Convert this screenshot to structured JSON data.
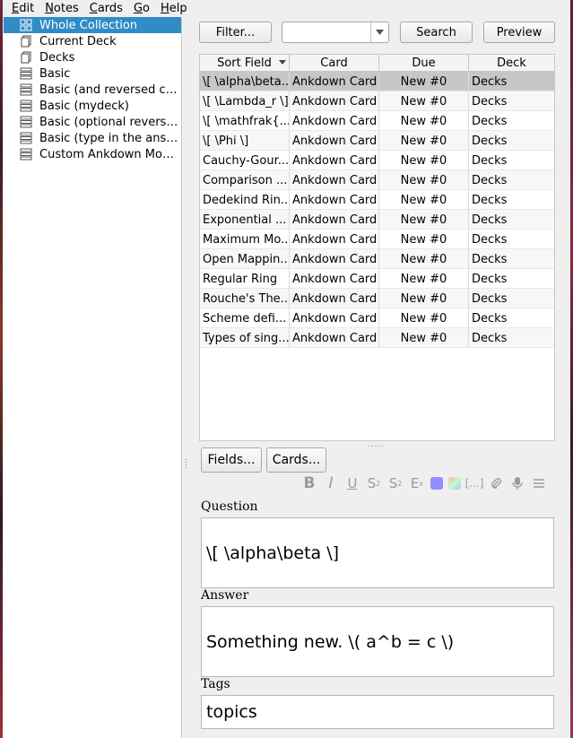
{
  "menu": [
    {
      "label": "Edit",
      "mnemonic": "E",
      "rest": "dit"
    },
    {
      "label": "Notes",
      "mnemonic": "N",
      "rest": "otes"
    },
    {
      "label": "Cards",
      "mnemonic": "C",
      "rest": "ards"
    },
    {
      "label": "Go",
      "mnemonic": "G",
      "rest": "o"
    },
    {
      "label": "Help",
      "mnemonic": "H",
      "rest": "elp"
    }
  ],
  "sidebar": {
    "items": [
      {
        "label": "Whole Collection",
        "icon": "collection-icon",
        "selected": true
      },
      {
        "label": "Current Deck",
        "icon": "deck-icon"
      },
      {
        "label": "Decks",
        "icon": "deck-icon"
      },
      {
        "label": "Basic",
        "icon": "note-type-icon"
      },
      {
        "label": "Basic (and reversed card)",
        "icon": "note-type-icon"
      },
      {
        "label": "Basic (mydeck)",
        "icon": "note-type-icon"
      },
      {
        "label": "Basic (optional reverse...",
        "icon": "note-type-icon"
      },
      {
        "label": "Basic (type in the answ...",
        "icon": "note-type-icon"
      },
      {
        "label": "Custom Ankdown Model",
        "icon": "note-type-icon"
      }
    ]
  },
  "toolbar": {
    "filter_label": "Filter...",
    "search_value": "",
    "search_label": "Search",
    "preview_label": "Preview"
  },
  "table": {
    "columns": [
      "Sort Field",
      "Card",
      "Due",
      "Deck"
    ],
    "rows": [
      [
        "\\[ \\alpha\\beta...",
        "Ankdown Card",
        "New #0",
        "Decks"
      ],
      [
        "\\[ \\Lambda_r \\]",
        "Ankdown Card",
        "New #0",
        "Decks"
      ],
      [
        "\\[ \\mathfrak{...",
        "Ankdown Card",
        "New #0",
        "Decks"
      ],
      [
        "\\[ \\Phi \\]",
        "Ankdown Card",
        "New #0",
        "Decks"
      ],
      [
        "Cauchy-Gour...",
        "Ankdown Card",
        "New #0",
        "Decks"
      ],
      [
        "Comparison ...",
        "Ankdown Card",
        "New #0",
        "Decks"
      ],
      [
        "Dedekind Rin...",
        "Ankdown Card",
        "New #0",
        "Decks"
      ],
      [
        "Exponential ...",
        "Ankdown Card",
        "New #0",
        "Decks"
      ],
      [
        "Maximum Mo...",
        "Ankdown Card",
        "New #0",
        "Decks"
      ],
      [
        "Open Mappin...",
        "Ankdown Card",
        "New #0",
        "Decks"
      ],
      [
        "Regular Ring",
        "Ankdown Card",
        "New #0",
        "Decks"
      ],
      [
        "Rouche's The...",
        "Ankdown Card",
        "New #0",
        "Decks"
      ],
      [
        "Scheme defi...",
        "Ankdown Card",
        "New #0",
        "Decks"
      ],
      [
        "Types of sing...",
        "Ankdown Card",
        "New #0",
        "Decks"
      ]
    ],
    "selected_row": 0
  },
  "editor": {
    "fields_label": "Fields...",
    "cards_label": "Cards...",
    "format_icons": [
      "bold-icon",
      "italic-icon",
      "underline-icon",
      "superscript-icon",
      "subscript-icon",
      "clear-format-icon",
      "text-color-icon",
      "highlight-color-icon",
      "cloze-icon",
      "attach-icon",
      "record-audio-icon",
      "more-icon"
    ],
    "question_label": "Question",
    "question_value": "\\[ \\alpha\\beta \\]",
    "answer_label": "Answer",
    "answer_value": "Something new. \\( a^b = c \\)",
    "tags_label": "Tags",
    "tags_value": "topics"
  },
  "colors": {
    "selection": "#308cc6",
    "row_selected": "#c7c7c7"
  }
}
